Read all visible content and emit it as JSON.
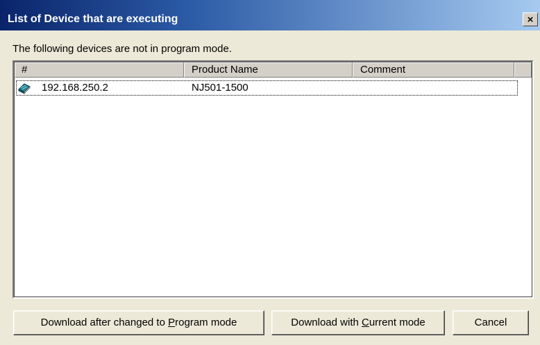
{
  "window": {
    "title": "List of Device that are executing",
    "close_symbol": "×"
  },
  "message": "The following devices are not in program mode.",
  "list": {
    "columns": [
      "#",
      "Product Name",
      "Comment"
    ],
    "rows": [
      {
        "icon": "device-book-icon",
        "address": "192.168.250.2",
        "product_name": "NJ501-1500",
        "comment": ""
      }
    ]
  },
  "buttons": {
    "program_mode": {
      "label_before": "Download after changed to ",
      "label_accel": "P",
      "label_after": "rogram mode"
    },
    "current_mode": {
      "label_before": "Download with ",
      "label_accel": "C",
      "label_after": "urrent mode"
    },
    "cancel": {
      "label": "Cancel"
    }
  },
  "colors": {
    "title_gradient_start": "#0a246a",
    "title_gradient_end": "#a6caf0",
    "dialog_face": "#ece9d8"
  }
}
